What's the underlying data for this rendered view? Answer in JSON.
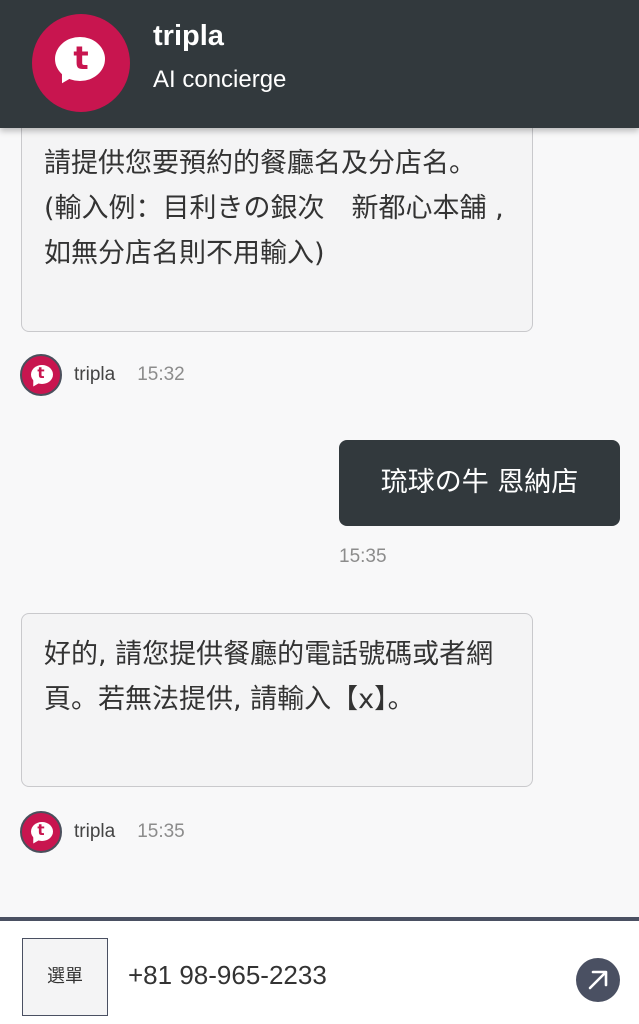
{
  "header": {
    "logo_letter": "t",
    "title": "tripla",
    "subtitle": "AI concierge"
  },
  "messages": [
    {
      "text": "請提供您要預約的餐廳名及分店名。(輸入例：目利きの銀次　新都心本舗 , 如無分店名則不用輸入)",
      "sender": "tripla",
      "time": "15:32"
    },
    {
      "text": "琉球の牛 恩納店",
      "time": "15:35"
    },
    {
      "text": "好的, 請您提供餐廳的電話號碼或者網頁。若無法提供, 請輸入【x】。",
      "sender": "tripla",
      "time": "15:35"
    }
  ],
  "footer": {
    "menu_label": "選單",
    "input_value": "+81 98-965-2233",
    "send_icon": "arrow-up-right-icon"
  },
  "colors": {
    "header_bg": "#32393d",
    "brand": "#c8154f",
    "user_bubble": "#32393d",
    "send_button": "#4a5062"
  }
}
